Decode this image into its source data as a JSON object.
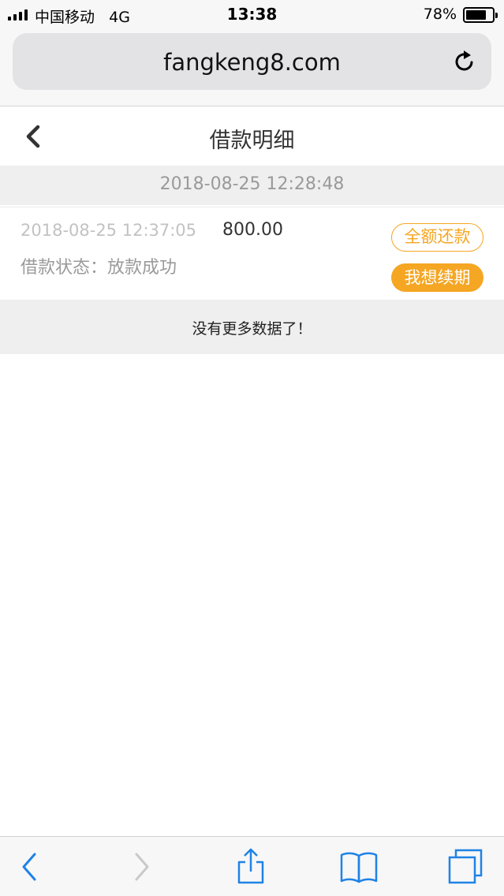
{
  "status_bar": {
    "carrier": "中国移动",
    "network": "4G",
    "time": "13:38",
    "battery_percent": "78%",
    "battery_level": 0.78
  },
  "browser": {
    "url": "fangkeng8.com"
  },
  "header": {
    "title": "借款明细"
  },
  "loan_group": {
    "date": "2018-08-25 12:28:48"
  },
  "loan": {
    "time": "2018-08-25 12:37:05",
    "amount": "800.00",
    "status_label": "借款状态：",
    "status_value": "放款成功",
    "repay_button": "全额还款",
    "renew_button": "我想续期"
  },
  "list_footer": {
    "text": "没有更多数据了！"
  },
  "colors": {
    "accent": "#f5a623",
    "ios_blue": "#1f82e6"
  }
}
